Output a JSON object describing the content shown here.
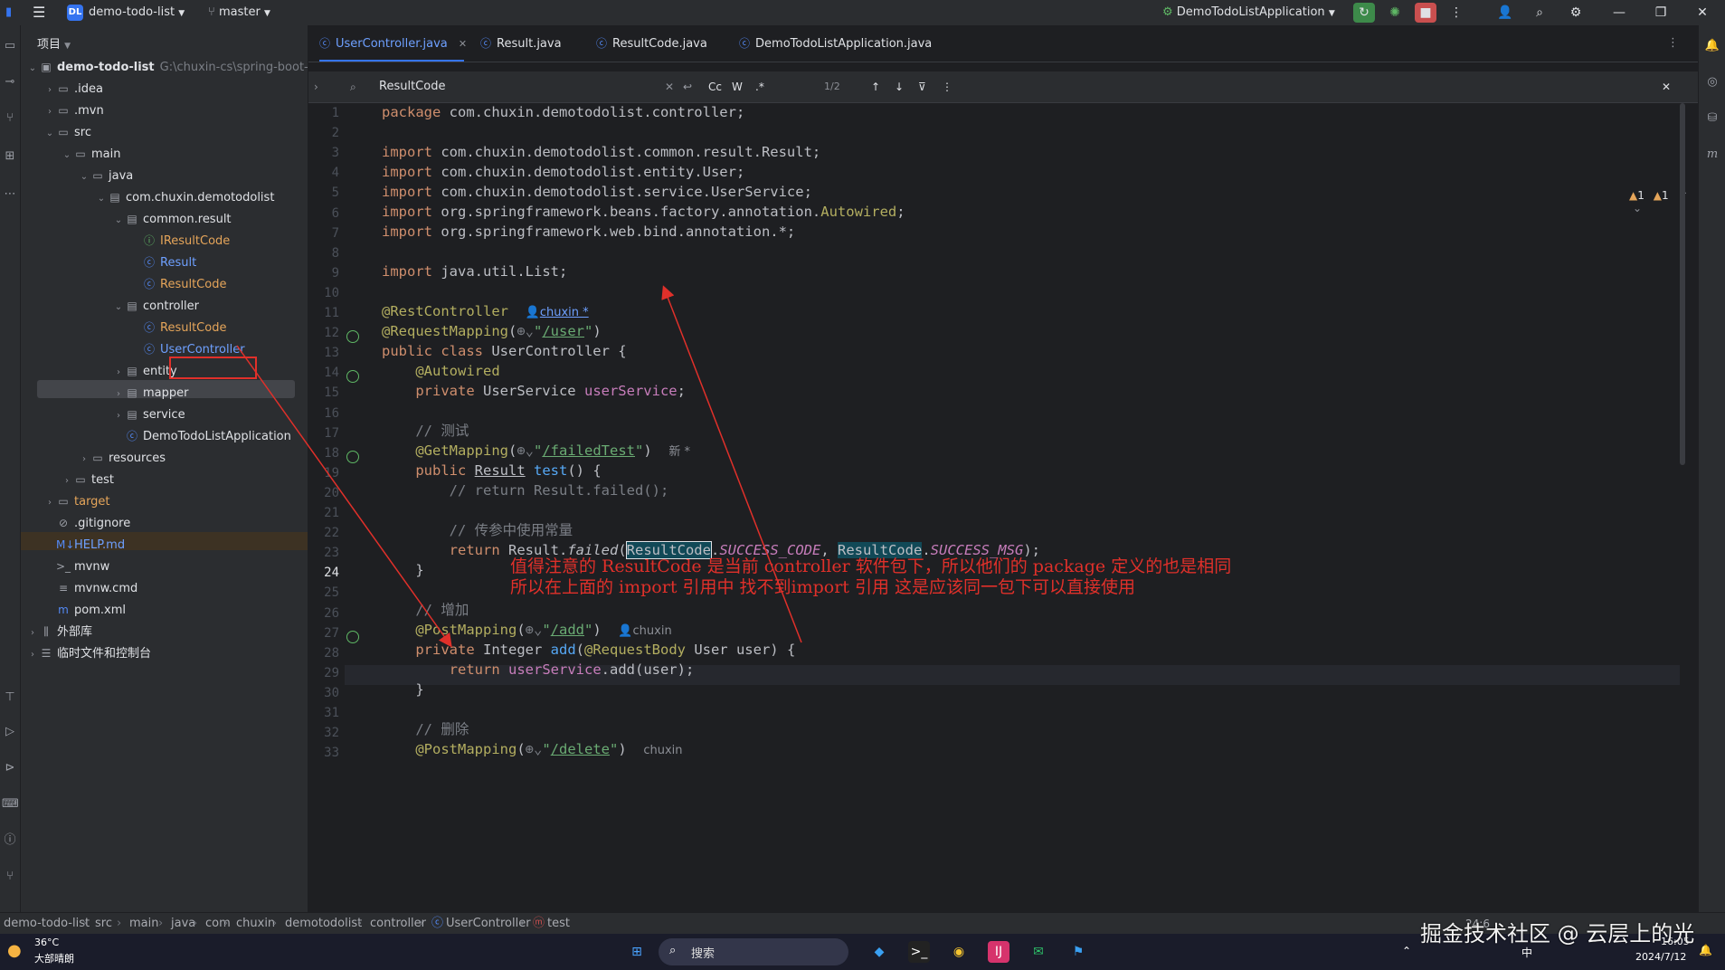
{
  "titlebar": {
    "project_badge": "DL",
    "project_name": "demo-todo-list",
    "branch": "master",
    "run_config": "DemoTodoListApplication"
  },
  "project_panel": {
    "header": "项目",
    "tree": [
      {
        "label": "demo-todo-list",
        "path": "G:\\chuxin-cs\\spring-boot-",
        "icon": "module-icon",
        "depth": 0,
        "expanded": true
      },
      {
        "label": ".idea",
        "icon": "folder-icon",
        "depth": 1,
        "expanded": false
      },
      {
        "label": ".mvn",
        "icon": "folder-icon",
        "depth": 1,
        "expanded": false
      },
      {
        "label": "src",
        "icon": "folder-icon",
        "depth": 1,
        "expanded": true
      },
      {
        "label": "main",
        "icon": "folder-icon",
        "depth": 2,
        "expanded": true
      },
      {
        "label": "java",
        "icon": "folder-icon",
        "depth": 3,
        "expanded": true
      },
      {
        "label": "com.chuxin.demotodolist",
        "icon": "package-icon",
        "depth": 4,
        "expanded": true
      },
      {
        "label": "common.result",
        "icon": "package-icon",
        "depth": 5,
        "expanded": true
      },
      {
        "label": "IResultCode",
        "icon": "interface-icon",
        "depth": 6
      },
      {
        "label": "Result",
        "icon": "class-icon",
        "depth": 6
      },
      {
        "label": "ResultCode",
        "icon": "class-icon",
        "depth": 6
      },
      {
        "label": "controller",
        "icon": "package-icon",
        "depth": 5,
        "expanded": true
      },
      {
        "label": "ResultCode",
        "icon": "class-icon",
        "depth": 6
      },
      {
        "label": "UserController",
        "icon": "class-icon",
        "depth": 6,
        "selected": true
      },
      {
        "label": "entity",
        "icon": "package-icon",
        "depth": 5,
        "expanded": false
      },
      {
        "label": "mapper",
        "icon": "package-icon",
        "depth": 5,
        "expanded": false
      },
      {
        "label": "service",
        "icon": "package-icon",
        "depth": 5,
        "expanded": false
      },
      {
        "label": "DemoTodoListApplication",
        "icon": "spring-class-icon",
        "depth": 5
      },
      {
        "label": "resources",
        "icon": "folder-icon",
        "depth": 3,
        "expanded": false
      },
      {
        "label": "test",
        "icon": "folder-icon",
        "depth": 2,
        "expanded": false
      },
      {
        "label": "target",
        "icon": "folder-icon",
        "depth": 1,
        "expanded": false
      },
      {
        "label": ".gitignore",
        "icon": "ignore-file-icon",
        "depth": 1
      },
      {
        "label": "HELP.md",
        "icon": "markdown-icon",
        "depth": 1
      },
      {
        "label": "mvnw",
        "icon": "terminal-file-icon",
        "depth": 1
      },
      {
        "label": "mvnw.cmd",
        "icon": "text-file-icon",
        "depth": 1
      },
      {
        "label": "pom.xml",
        "icon": "maven-icon",
        "depth": 1
      },
      {
        "label": "外部库",
        "icon": "library-icon",
        "depth": 0,
        "expanded": false
      },
      {
        "label": "临时文件和控制台",
        "icon": "scratch-icon",
        "depth": 0,
        "expanded": false
      }
    ]
  },
  "tabs": [
    {
      "label": "UserController.java",
      "active": true,
      "closable": true
    },
    {
      "label": "Result.java",
      "active": false
    },
    {
      "label": "ResultCode.java",
      "active": false
    },
    {
      "label": "DemoTodoListApplication.java",
      "active": false
    }
  ],
  "search": {
    "query": "ResultCode",
    "case_toggle": "Cc",
    "word_toggle": "W",
    "regex_toggle": ".*",
    "match_count": "1/2"
  },
  "inspections": {
    "warnings": "1",
    "weak_warnings": "1"
  },
  "editor": {
    "line_numbers": [
      "1",
      "2",
      "3",
      "4",
      "5",
      "6",
      "7",
      "8",
      "9",
      "10",
      "11",
      "12",
      "13",
      "14",
      "15",
      "16",
      "17",
      "18",
      "19",
      "20",
      "21",
      "22",
      "23",
      "24",
      "25",
      "26",
      "27",
      "28",
      "29",
      "30",
      "31",
      "32",
      "33"
    ],
    "authors": {
      "line11": "chuxin *",
      "line18": "新 *",
      "line27": "chuxin",
      "line33": "chuxin"
    }
  },
  "annotation": {
    "line1": "值得注意的  ResultCode 是当前 controller 软件包下，所以他们的 package 定义的也是相同",
    "line2": "所以在上面的 import 引用中 找不到import 引用 这是应该同一包下可以直接使用"
  },
  "breadcrumb": [
    "demo-todo-list",
    "src",
    "main",
    "java",
    "com",
    "chuxin",
    "demotodolist",
    "controller",
    "UserController",
    "test"
  ],
  "status": {
    "cursor": "24:6"
  },
  "taskbar": {
    "weather_temp": "36°C",
    "weather_desc": "大部晴朗",
    "search_placeholder": "搜索",
    "ime": "中",
    "time": "16:05",
    "date": "2024/7/12"
  },
  "watermark": "掘金技术社区 @ 云层上的光",
  "colors": {
    "accent": "#3574f0",
    "annotation_red": "#e0302a",
    "background": "#1e1f22",
    "panel": "#2b2d30"
  }
}
